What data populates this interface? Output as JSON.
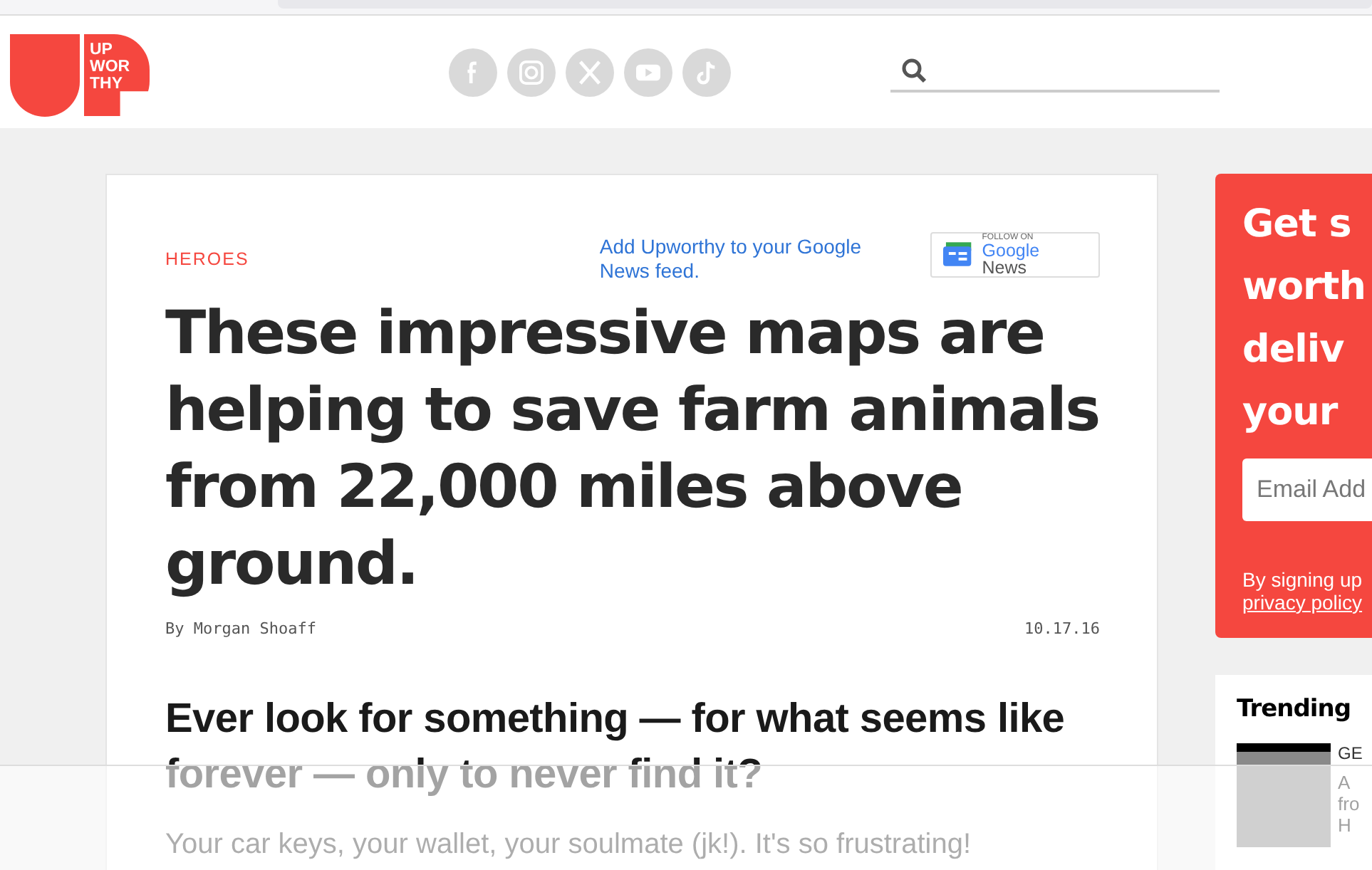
{
  "header": {
    "logo": [
      "UP",
      "WOR",
      "THY"
    ],
    "social": [
      {
        "kind": "facebook"
      },
      {
        "kind": "instagram"
      },
      {
        "kind": "x"
      },
      {
        "kind": "youtube"
      },
      {
        "kind": "tiktok"
      }
    ]
  },
  "article": {
    "category": "HEROES",
    "google_news_link": "Add Upworthy to your Google News feed.",
    "google_news_badge": {
      "small": "FOLLOW ON",
      "brand": "Google",
      "label": "News"
    },
    "title": "These impressive maps are helping to save farm animals from 22,000 miles above ground.",
    "author": "By Morgan Shoaff",
    "date": "10.17.16",
    "subheading": "Ever look for something — for what seems like forever — only to never find it?",
    "paragraph": "Your car keys, your wallet, your soulmate (jk!). It's so frustrating!"
  },
  "newsletter": {
    "heading_lines": [
      "Get s",
      "worth",
      "deliv",
      "your"
    ],
    "placeholder": "Email Add",
    "note": "By signing up",
    "link": "privacy policy"
  },
  "trending": {
    "title": "Trending",
    "items": [
      {
        "category": "GE",
        "lines": [
          "A",
          "fro",
          "H"
        ]
      }
    ]
  }
}
